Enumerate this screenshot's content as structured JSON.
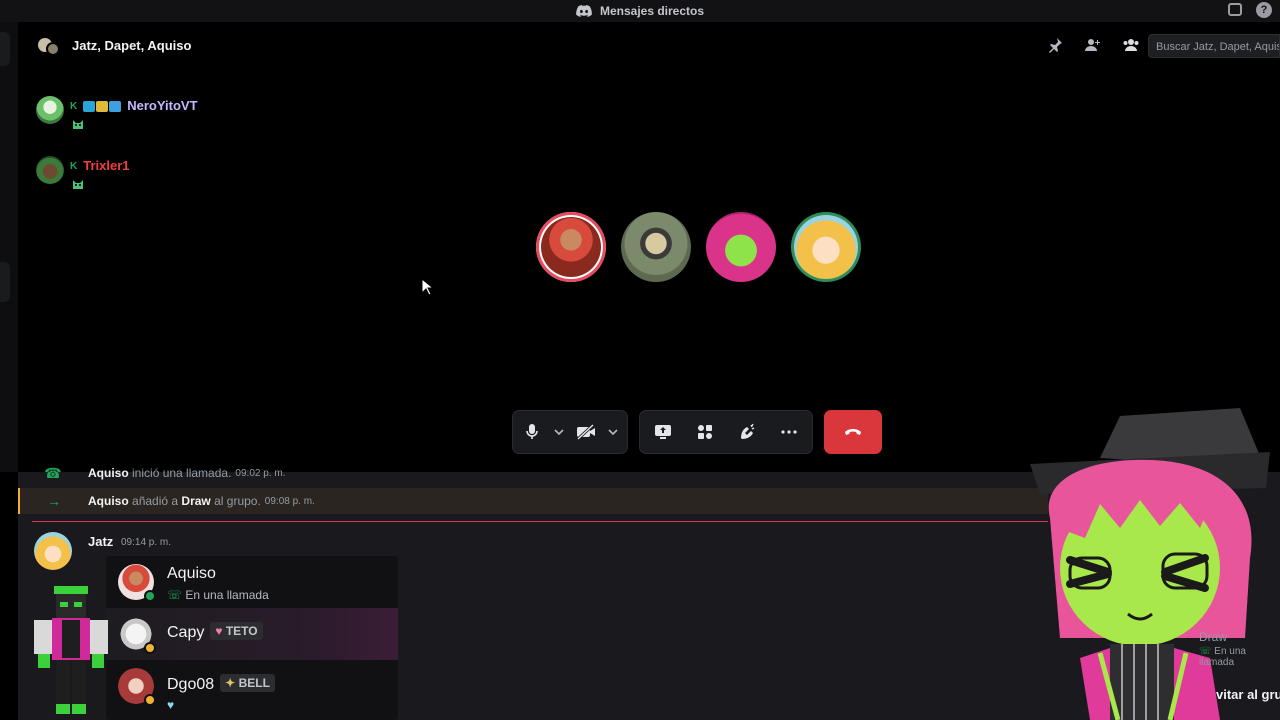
{
  "titlebar": {
    "title": "Mensajes directos"
  },
  "call": {
    "header_title": "Jatz, Dapet, Aquiso",
    "search_placeholder": "Buscar Jatz, Dapet, Aquiso",
    "voice_users": [
      {
        "prefix": "K",
        "name": "NeroYitoVT",
        "color": "#c9b6ff"
      },
      {
        "prefix": "K",
        "name": "Trixler1",
        "color": "#f23f42"
      }
    ],
    "participants": [
      {
        "id": "aquiso",
        "ring": "#e84a5f"
      },
      {
        "id": "dapet"
      },
      {
        "id": "draw"
      },
      {
        "id": "jatz",
        "ring": "#2d8c5a"
      }
    ]
  },
  "chat": {
    "system_messages": [
      {
        "actor": "Aquiso",
        "text": "inició una llamada.",
        "time": "09:02 p. m."
      },
      {
        "actor": "Aquiso",
        "text_before": "añadió a",
        "target": "Draw",
        "text_after": "al grupo.",
        "time": "09:08 p. m."
      }
    ],
    "message": {
      "author": "Jatz",
      "time": "09:14 p. m.",
      "members": [
        {
          "name": "Aquiso",
          "status": "En una llamada"
        },
        {
          "name": "Capy",
          "tag": "TETO"
        },
        {
          "name": "Dgo08",
          "tag": "BELL"
        }
      ]
    }
  },
  "overlay": {
    "name": "Draw",
    "status": "En una llamada",
    "invite_text": "vitar al gru"
  }
}
